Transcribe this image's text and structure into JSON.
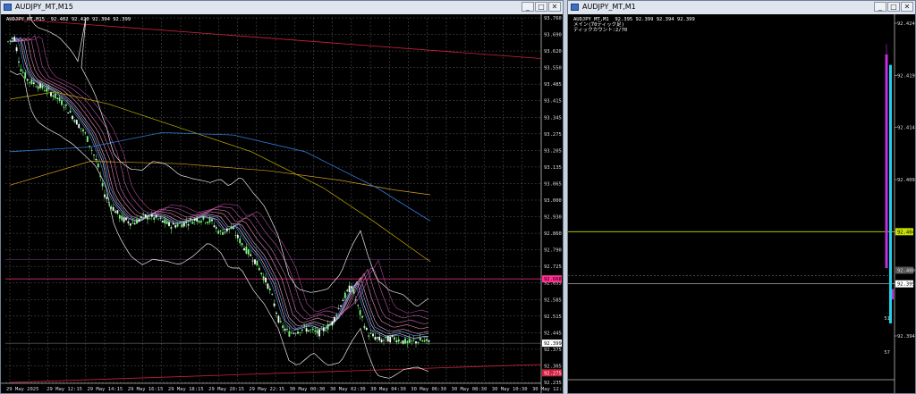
{
  "left": {
    "title": "AUDJPY_MT,M15",
    "header": "AUDJPY_MT,M15  92.402 92.420 92.394 92.399",
    "yticks": [
      "93.760",
      "93.690",
      "93.620",
      "93.550",
      "93.485",
      "93.415",
      "93.345",
      "93.275",
      "93.205",
      "93.135",
      "93.065",
      "93.000",
      "92.930",
      "92.860",
      "92.790",
      "92.725",
      "92.655",
      "92.585",
      "92.515",
      "92.445",
      "92.375",
      "92.305",
      "92.235"
    ],
    "xticks": [
      "29 May 2025",
      "29 May 12:15",
      "29 May 14:15",
      "29 May 16:15",
      "29 May 18:15",
      "29 May 20:15",
      "29 May 22:15",
      "30 May 00:30",
      "30 May 02:30",
      "30 May 04:30",
      "30 May 06:30",
      "30 May 08:30",
      "30 May 10:30",
      "30 May 12:30"
    ],
    "price_labels": {
      "pink": "92.668",
      "current": "92.399",
      "red": "92.275"
    }
  },
  "right": {
    "title": "AUDJPY_MT,M1",
    "header_line1": "AUDJPY_MT,M1  92.395 92.399 92.394 92.399",
    "header_line2": "メイン(70ティック足)",
    "header_line3": "ティックカウント:2/70",
    "yticks": [
      "92.424",
      "92.419",
      "92.414",
      "92.409",
      "92.404",
      "92.399",
      "92.394"
    ],
    "price_labels": {
      "yellow": "92.404",
      "gray": "92.400",
      "current": "92.399"
    },
    "bar_nums": [
      "51",
      "57"
    ]
  },
  "colors": {
    "up_candle": "#7cfc7c",
    "grid": "#5a5a5a",
    "band": "#e8e8e8",
    "ema_blue": "#2f78d6",
    "ema_orange": "#d8a020",
    "trend_red": "#d02040",
    "magenta_bar": "#c030e0",
    "cyan_bar": "#20d0e8"
  }
}
